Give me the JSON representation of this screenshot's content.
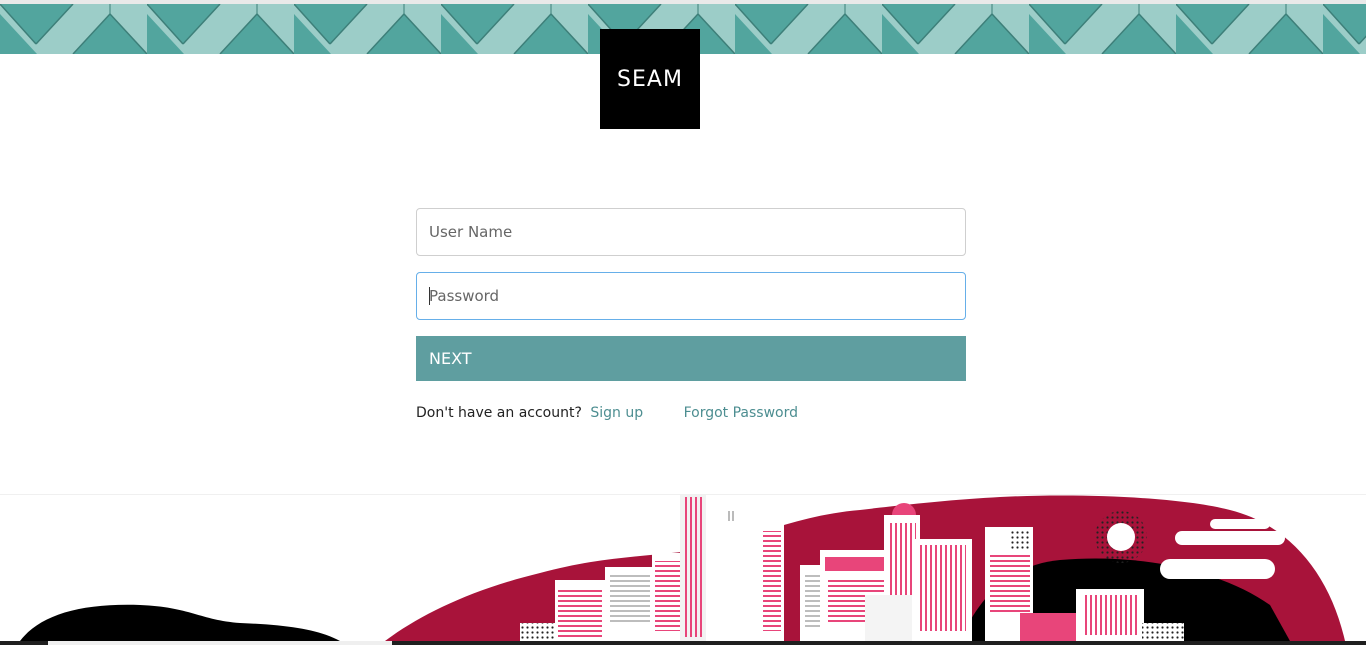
{
  "brand": {
    "logo_text": "SEAM"
  },
  "login_form": {
    "username_placeholder": "User Name",
    "password_placeholder": "Password",
    "next_label": "NEXT",
    "no_account_text": "Don't have an account?",
    "signup_link": "Sign up",
    "forgot_link": "Forgot Password"
  },
  "colors": {
    "banner_light": "#9ccdc8",
    "banner_dark": "#52a59e",
    "button": "#5f9ea0",
    "link": "#4d8e91",
    "city_crimson": "#a8133a",
    "city_pink": "#e8457a"
  }
}
